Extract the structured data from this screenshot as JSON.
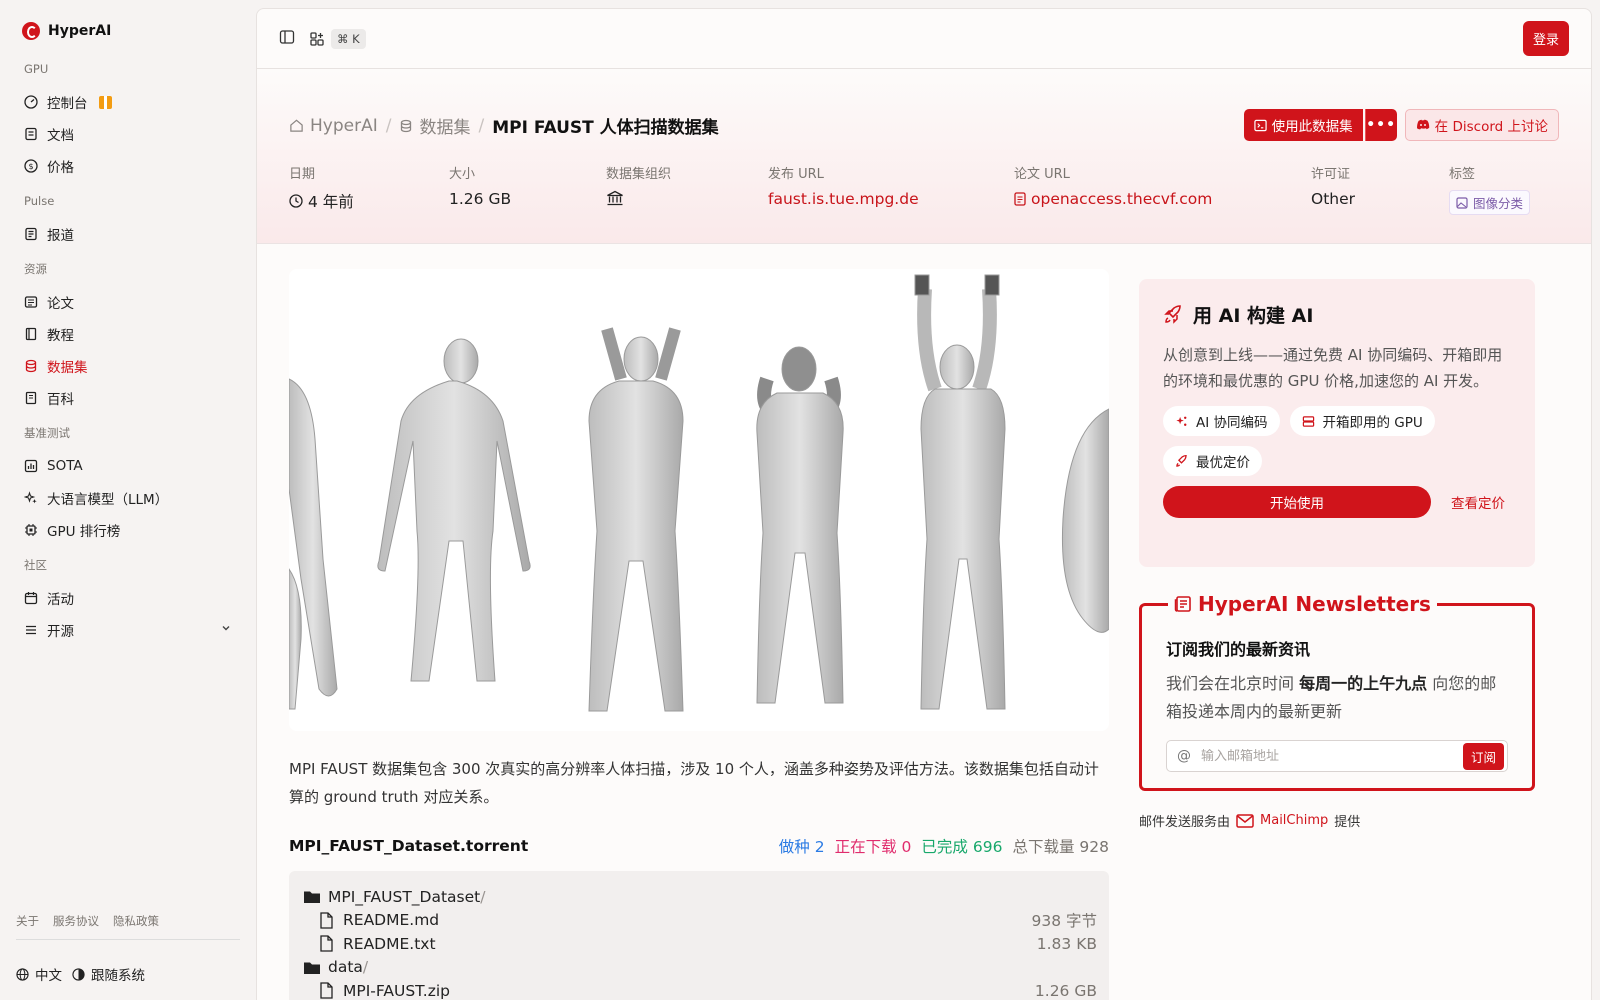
{
  "brand": {
    "name": "HyperAI"
  },
  "sidebar": {
    "sections": [
      {
        "label": "GPU",
        "items": [
          {
            "label": "控制台",
            "icon": "gauge-icon",
            "badge": "gift-icon"
          },
          {
            "label": "文档",
            "icon": "doc-icon"
          },
          {
            "label": "价格",
            "icon": "dollar-icon"
          }
        ]
      },
      {
        "label": "Pulse",
        "items": [
          {
            "label": "报道",
            "icon": "news-icon"
          }
        ]
      },
      {
        "label": "资源",
        "items": [
          {
            "label": "论文",
            "icon": "paper-icon"
          },
          {
            "label": "教程",
            "icon": "book-icon"
          },
          {
            "label": "数据集",
            "icon": "database-icon",
            "active": true
          },
          {
            "label": "百科",
            "icon": "wiki-icon"
          }
        ]
      },
      {
        "label": "基准测试",
        "items": [
          {
            "label": "SOTA",
            "icon": "chart-icon"
          },
          {
            "label": "大语言模型（LLM）",
            "icon": "sparkle-icon"
          },
          {
            "label": "GPU 排行榜",
            "icon": "chip-icon"
          }
        ]
      },
      {
        "label": "社区",
        "items": [
          {
            "label": "活动",
            "icon": "calendar-icon"
          },
          {
            "label": "开源",
            "icon": "list-icon",
            "expandable": true
          }
        ]
      }
    ],
    "footer_links": [
      "关于",
      "服务协议",
      "隐私政策"
    ],
    "language": "中文",
    "theme": "跟随系统"
  },
  "topbar": {
    "shortcut": "⌘ K",
    "login": "登录"
  },
  "breadcrumb": {
    "home": "HyperAI",
    "section": "数据集",
    "current": "MPI FAUST 人体扫描数据集"
  },
  "actions": {
    "use_dataset": "使用此数据集",
    "more": "•••",
    "discord": "在 Discord 上讨论"
  },
  "meta": {
    "date_label": "日期",
    "date_value": "4 年前",
    "size_label": "大小",
    "size_value": "1.26 GB",
    "org_label": "数据集组织",
    "url_label": "发布 URL",
    "url_value": "faust.is.tue.mpg.de",
    "paper_label": "论文 URL",
    "paper_value": "openaccess.thecvf.com",
    "license_label": "许可证",
    "license_value": "Other",
    "tags_label": "标签",
    "tag_value": "图像分类"
  },
  "description": "MPI FAUST 数据集包含 300 次真实的高分辨率人体扫描，涉及 10 个人，涵盖多种姿势及评估方法。该数据集包括自动计算的 ground truth 对应关系。",
  "torrent": {
    "title": "MPI_FAUST_Dataset.torrent",
    "seeding_label": "做种",
    "seeding": "2",
    "downloading_label": "正在下载",
    "downloading": "0",
    "completed_label": "已完成",
    "completed": "696",
    "total_label": "总下载量",
    "total": "928",
    "files": [
      {
        "name": "MPI_FAUST_Dataset",
        "type": "folder",
        "level": 0,
        "size": ""
      },
      {
        "name": "README.md",
        "type": "file",
        "level": 1,
        "size": "938 字节"
      },
      {
        "name": "README.txt",
        "type": "file",
        "level": 1,
        "size": "1.83 KB"
      },
      {
        "name": "data",
        "type": "folder",
        "level": 0,
        "size": ""
      },
      {
        "name": "MPI-FAUST.zip",
        "type": "file",
        "level": 1,
        "size": "1.26 GB"
      }
    ]
  },
  "promo": {
    "title": "用 AI 构建 AI",
    "text": "从创意到上线——通过免费 AI 协同编码、开箱即用的环境和最优惠的 GPU 价格,加速您的 AI 开发。",
    "chips": [
      "AI 协同编码",
      "开箱即用的 GPU",
      "最优定价"
    ],
    "start": "开始使用",
    "pricing": "查看定价"
  },
  "newsletter": {
    "legend": "HyperAI Newsletters",
    "subtitle": "订阅我们的最新资讯",
    "text_pre": "我们会在北京时间 ",
    "text_bold": "每周一的上午九点",
    "text_post": " 向您的邮箱投递本周内的最新更新",
    "placeholder": "输入邮箱地址",
    "subscribe": "订阅",
    "provider_pre": "邮件发送服务由",
    "provider": "MailChimp",
    "provider_post": "提供"
  },
  "colors": {
    "accent": "#d0141b",
    "seed": "#2b7be4",
    "downloading": "#e02c6d",
    "completed": "#18a86b"
  }
}
